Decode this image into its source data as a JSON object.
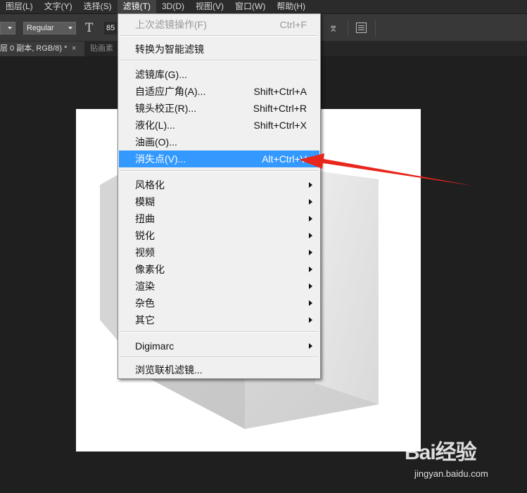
{
  "menubar": {
    "items": [
      {
        "label": "图层(L)"
      },
      {
        "label": "文字(Y)"
      },
      {
        "label": "选择(S)"
      },
      {
        "label": "滤镜(T)"
      },
      {
        "label": "3D(D)"
      },
      {
        "label": "视图(V)"
      },
      {
        "label": "窗口(W)"
      },
      {
        "label": "帮助(H)"
      }
    ],
    "active_item": "滤镜(T)"
  },
  "options_bar": {
    "font_style": "Regular",
    "font_size_partial": "85",
    "icons": [
      "text-orientation-icon",
      "warp-text-icon",
      "character-panel-icon"
    ]
  },
  "tabs": [
    {
      "label": "层 0 副本, RGB/8) *",
      "close": "×"
    },
    {
      "label": "贴画素"
    }
  ],
  "filter_menu": {
    "items": [
      {
        "label": "上次滤镜操作(F)",
        "shortcut": "Ctrl+F",
        "disabled": true
      },
      {
        "label": "转换为智能滤镜"
      },
      {
        "label": "滤镜库(G)..."
      },
      {
        "label": "自适应广角(A)...",
        "shortcut": "Shift+Ctrl+A"
      },
      {
        "label": "镜头校正(R)...",
        "shortcut": "Shift+Ctrl+R"
      },
      {
        "label": "液化(L)...",
        "shortcut": "Shift+Ctrl+X"
      },
      {
        "label": "油画(O)..."
      },
      {
        "label": "消失点(V)...",
        "shortcut": "Alt+Ctrl+V",
        "highlighted": true
      },
      {
        "label": "风格化",
        "submenu": true
      },
      {
        "label": "模糊",
        "submenu": true
      },
      {
        "label": "扭曲",
        "submenu": true
      },
      {
        "label": "锐化",
        "submenu": true
      },
      {
        "label": "视频",
        "submenu": true
      },
      {
        "label": "像素化",
        "submenu": true
      },
      {
        "label": "渲染",
        "submenu": true
      },
      {
        "label": "杂色",
        "submenu": true
      },
      {
        "label": "其它",
        "submenu": true
      },
      {
        "label": "Digimarc",
        "submenu": true
      },
      {
        "label": "浏览联机滤镜..."
      }
    ]
  },
  "annotation": {
    "color": "#e8261c"
  },
  "watermark": {
    "logo": "Bai经验",
    "url": "jingyan.baidu.com"
  },
  "colors": {
    "highlight": "#3399ff",
    "menu_bg": "#f0f0f0",
    "app_bg": "#1f1f1f"
  }
}
